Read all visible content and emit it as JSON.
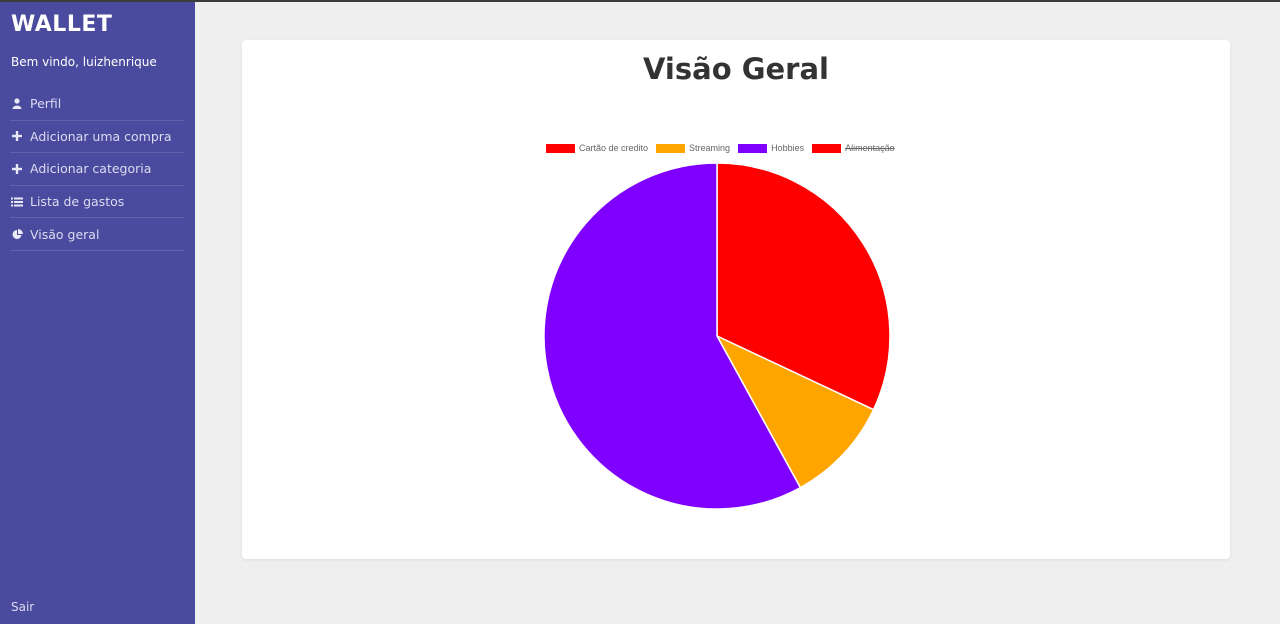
{
  "sidebar": {
    "brand": "WALLET",
    "welcome": "Bem vindo, luizhenrique",
    "items": [
      {
        "label": "Perfil",
        "icon": "user-icon"
      },
      {
        "label": "Adicionar uma compra",
        "icon": "plus-icon"
      },
      {
        "label": "Adicionar categoria",
        "icon": "plus-icon"
      },
      {
        "label": "Lista de gastos",
        "icon": "list-icon"
      },
      {
        "label": "Visão geral",
        "icon": "pie-chart-icon"
      }
    ],
    "logout": "Sair"
  },
  "main": {
    "title": "Visão Geral"
  },
  "colors": {
    "sidebar_bg": "#4a4a9e",
    "page_bg": "#efefef"
  },
  "chart_data": {
    "type": "pie",
    "categories": [
      "Cartão de credito",
      "Streaming",
      "Hobbies",
      "Alimentação"
    ],
    "values": [
      32,
      10,
      58,
      0
    ],
    "colors": [
      "#ff0000",
      "#ffa500",
      "#7f00ff",
      "#ff0000"
    ],
    "hidden": [
      false,
      false,
      false,
      true
    ],
    "legend": "top"
  }
}
